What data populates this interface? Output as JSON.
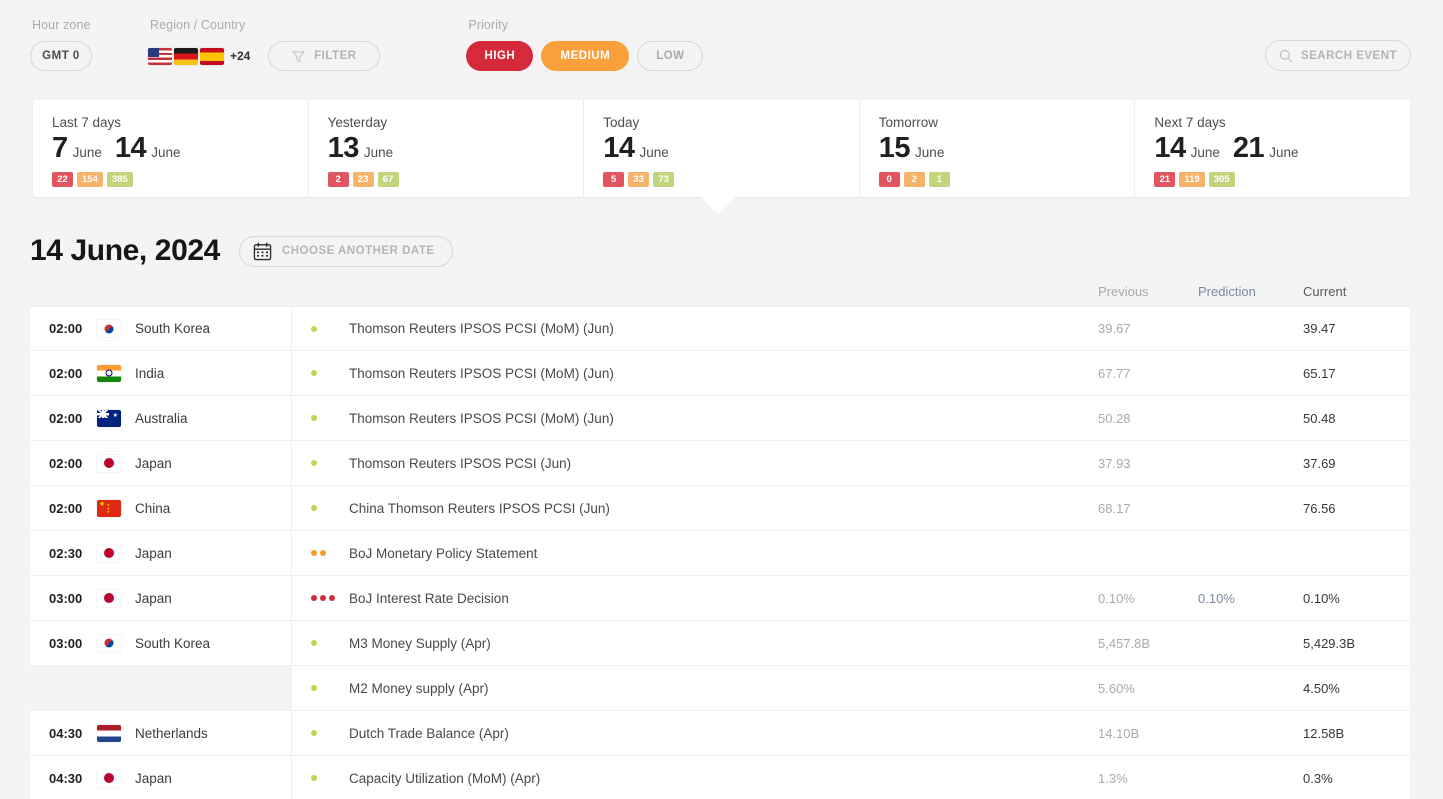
{
  "toolbar": {
    "hour_zone_label": "Hour zone",
    "hour_zone_value": "GMT 0",
    "region_label": "Region / Country",
    "region_more": "+24",
    "filter_label": "FILTER",
    "priority_label": "Priority",
    "priority_high": "HIGH",
    "priority_medium": "MEDIUM",
    "priority_low": "LOW",
    "search_label": "SEARCH EVENT",
    "colors": {
      "high": "#d6293a",
      "medium": "#f9a03a",
      "low": "#a9aaac"
    }
  },
  "cards": [
    {
      "title": "Last 7 days",
      "day1": "7",
      "mon1": "June",
      "day2": "14",
      "mon2": "June",
      "high": "22",
      "medium": "154",
      "low": "385"
    },
    {
      "title": "Yesterday",
      "day1": "13",
      "mon1": "June",
      "day2": "",
      "mon2": "",
      "high": "2",
      "medium": "23",
      "low": "67"
    },
    {
      "title": "Today",
      "day1": "14",
      "mon1": "June",
      "day2": "",
      "mon2": "",
      "high": "5",
      "medium": "33",
      "low": "73"
    },
    {
      "title": "Tomorrow",
      "day1": "15",
      "mon1": "June",
      "day2": "",
      "mon2": "",
      "high": "0",
      "medium": "2",
      "low": "1"
    },
    {
      "title": "Next 7 days",
      "day1": "14",
      "mon1": "June",
      "day2": "21",
      "mon2": "June",
      "high": "21",
      "medium": "119",
      "low": "305"
    }
  ],
  "date_section": {
    "title": "14 June, 2024",
    "choose_date_label": "CHOOSE ANOTHER DATE"
  },
  "table": {
    "headers": {
      "previous": "Previous",
      "prediction": "Prediction",
      "current": "Current"
    },
    "rows": [
      {
        "time": "02:00",
        "country": "South Korea",
        "flag": "kr",
        "priority": "low",
        "event": "Thomson Reuters IPSOS PCSI (MoM) (Jun)",
        "previous": "39.67",
        "prediction": "",
        "current": "39.47"
      },
      {
        "time": "02:00",
        "country": "India",
        "flag": "in",
        "priority": "low",
        "event": "Thomson Reuters IPSOS PCSI (MoM) (Jun)",
        "previous": "67.77",
        "prediction": "",
        "current": "65.17"
      },
      {
        "time": "02:00",
        "country": "Australia",
        "flag": "au",
        "priority": "low",
        "event": "Thomson Reuters IPSOS PCSI (MoM) (Jun)",
        "previous": "50.28",
        "prediction": "",
        "current": "50.48"
      },
      {
        "time": "02:00",
        "country": "Japan",
        "flag": "jp",
        "priority": "low",
        "event": "Thomson Reuters IPSOS PCSI (Jun)",
        "previous": "37.93",
        "prediction": "",
        "current": "37.69"
      },
      {
        "time": "02:00",
        "country": "China",
        "flag": "cn",
        "priority": "low",
        "event": "China Thomson Reuters IPSOS PCSI (Jun)",
        "previous": "68.17",
        "prediction": "",
        "current": "76.56"
      },
      {
        "time": "02:30",
        "country": "Japan",
        "flag": "jp",
        "priority": "medium",
        "event": "BoJ Monetary Policy Statement",
        "previous": "",
        "prediction": "",
        "current": ""
      },
      {
        "time": "03:00",
        "country": "Japan",
        "flag": "jp",
        "priority": "high",
        "event": "BoJ Interest Rate Decision",
        "previous": "0.10%",
        "prediction": "0.10%",
        "current": "0.10%"
      },
      {
        "time": "03:00",
        "country": "South Korea",
        "flag": "kr",
        "priority": "low",
        "event": "M3 Money Supply (Apr)",
        "previous": "5,457.8B",
        "prediction": "",
        "current": "5,429.3B"
      },
      {
        "time": "",
        "country": "",
        "flag": "",
        "priority": "low",
        "event": "M2 Money supply (Apr)",
        "previous": "5.60%",
        "prediction": "",
        "current": "4.50%"
      },
      {
        "time": "04:30",
        "country": "Netherlands",
        "flag": "nl",
        "priority": "low",
        "event": "Dutch Trade Balance (Apr)",
        "previous": "14.10B",
        "prediction": "",
        "current": "12.58B"
      },
      {
        "time": "04:30",
        "country": "Japan",
        "flag": "jp",
        "priority": "low",
        "event": "Capacity Utilization (MoM) (Apr)",
        "previous": "1.3%",
        "prediction": "",
        "current": "0.3%"
      }
    ]
  }
}
